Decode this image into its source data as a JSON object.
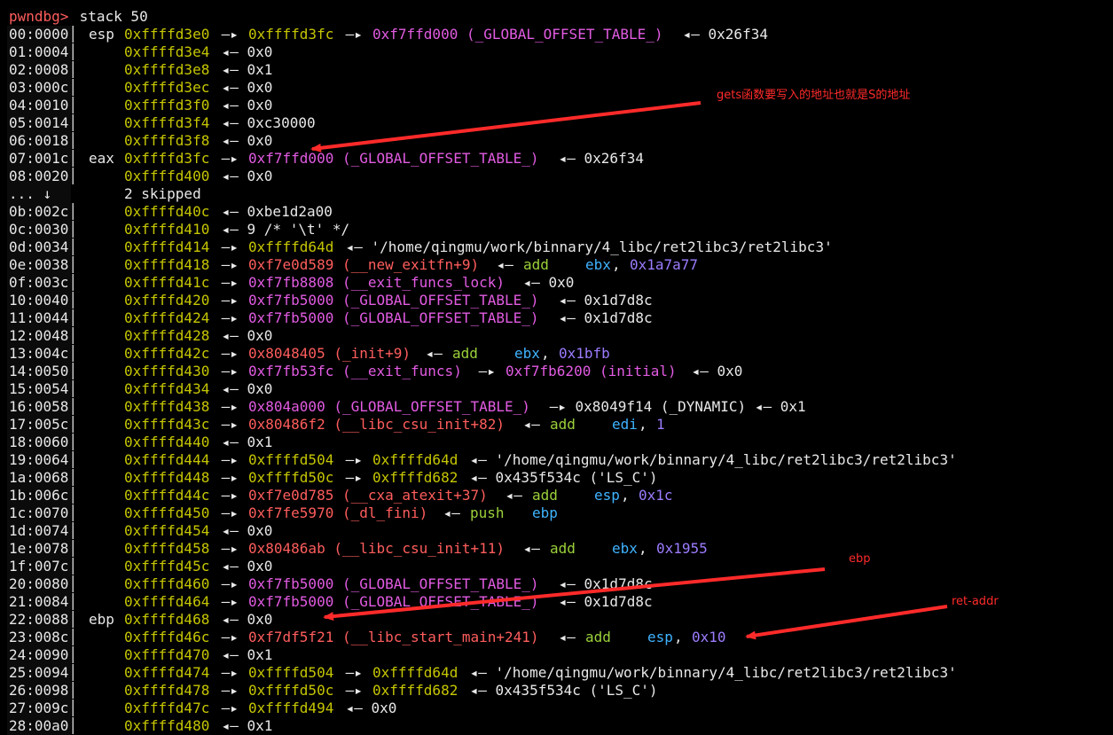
{
  "colors": {
    "default": "#e8e8e8",
    "prompt": "#ff5d5d",
    "stack": "#c6c600",
    "heap": "#e25be2",
    "code": "#ff5d5d",
    "mnemonic": "#9bd13a",
    "register": "#3fb3ff",
    "number": "#9c7cff",
    "annotation": "#ff2a2a"
  },
  "prompt": {
    "name": "pwndbg>",
    "command": " stack 50"
  },
  "stack_lines": [
    {
      "segs": [
        [
          "00:0000│ ",
          "default"
        ],
        [
          "esp ",
          "default"
        ],
        [
          "0xffffd3e0",
          "stack"
        ],
        [
          " —▸ ",
          "default"
        ],
        [
          "0xffffd3fc",
          "stack"
        ],
        [
          " —▸ ",
          "default"
        ],
        [
          "0xf7ffd000 (_GLOBAL_OFFSET_TABLE_)",
          "heap"
        ],
        [
          " ◂— 0x26f34",
          "default"
        ]
      ]
    },
    {
      "segs": [
        [
          "01:0004│ ",
          "default"
        ],
        [
          "    ",
          "default"
        ],
        [
          "0xffffd3e4",
          "stack"
        ],
        [
          " ◂— 0x0",
          "default"
        ]
      ]
    },
    {
      "segs": [
        [
          "02:0008│ ",
          "default"
        ],
        [
          "    ",
          "default"
        ],
        [
          "0xffffd3e8",
          "stack"
        ],
        [
          " ◂— 0x1",
          "default"
        ]
      ]
    },
    {
      "segs": [
        [
          "03:000c│ ",
          "default"
        ],
        [
          "    ",
          "default"
        ],
        [
          "0xffffd3ec",
          "stack"
        ],
        [
          " ◂— 0x0",
          "default"
        ]
      ]
    },
    {
      "segs": [
        [
          "04:0010│ ",
          "default"
        ],
        [
          "    ",
          "default"
        ],
        [
          "0xffffd3f0",
          "stack"
        ],
        [
          " ◂— 0x0",
          "default"
        ]
      ]
    },
    {
      "segs": [
        [
          "05:0014│ ",
          "default"
        ],
        [
          "    ",
          "default"
        ],
        [
          "0xffffd3f4",
          "stack"
        ],
        [
          " ◂— 0xc30000",
          "default"
        ]
      ]
    },
    {
      "segs": [
        [
          "06:0018│ ",
          "default"
        ],
        [
          "    ",
          "default"
        ],
        [
          "0xffffd3f8",
          "stack"
        ],
        [
          " ◂— 0x0",
          "default"
        ]
      ]
    },
    {
      "segs": [
        [
          "07:001c│ ",
          "default"
        ],
        [
          "eax ",
          "default"
        ],
        [
          "0xffffd3fc",
          "stack"
        ],
        [
          " —▸ ",
          "default"
        ],
        [
          "0xf7ffd000 (_GLOBAL_OFFSET_TABLE_)",
          "heap"
        ],
        [
          " ◂— 0x26f34",
          "default"
        ]
      ]
    },
    {
      "segs": [
        [
          "08:0020│ ",
          "default"
        ],
        [
          "    ",
          "default"
        ],
        [
          "0xffffd400",
          "stack"
        ],
        [
          " ◂— 0x0",
          "default"
        ]
      ]
    },
    {
      "segs": [
        [
          "... ↓   ",
          "default"
        ],
        [
          "     ",
          "default"
        ],
        [
          "2 skipped",
          "default"
        ]
      ]
    },
    {
      "segs": [
        [
          "0b:002c│ ",
          "default"
        ],
        [
          "    ",
          "default"
        ],
        [
          "0xffffd40c",
          "stack"
        ],
        [
          " ◂— 0xbe1d2a00",
          "default"
        ]
      ]
    },
    {
      "segs": [
        [
          "0c:0030│ ",
          "default"
        ],
        [
          "    ",
          "default"
        ],
        [
          "0xffffd410",
          "stack"
        ],
        [
          " ◂— 9 /* '\\t' */",
          "default"
        ]
      ]
    },
    {
      "segs": [
        [
          "0d:0034│ ",
          "default"
        ],
        [
          "    ",
          "default"
        ],
        [
          "0xffffd414",
          "stack"
        ],
        [
          " —▸ ",
          "default"
        ],
        [
          "0xffffd64d",
          "stack"
        ],
        [
          " ◂— '/home/qingmu/work/binnary/4_libc/ret2libc3/ret2libc3'",
          "default"
        ]
      ]
    },
    {
      "segs": [
        [
          "0e:0038│ ",
          "default"
        ],
        [
          "    ",
          "default"
        ],
        [
          "0xffffd418",
          "stack"
        ],
        [
          " —▸ ",
          "default"
        ],
        [
          "0xf7e0d589 (__new_exitfn+9)",
          "code"
        ],
        [
          " ◂— ",
          "default"
        ],
        [
          "add",
          "mnemonic"
        ],
        [
          "    ",
          "default"
        ],
        [
          "ebx",
          "register"
        ],
        [
          ", ",
          "default"
        ],
        [
          "0x1a7a77",
          "number"
        ]
      ]
    },
    {
      "segs": [
        [
          "0f:003c│ ",
          "default"
        ],
        [
          "    ",
          "default"
        ],
        [
          "0xffffd41c",
          "stack"
        ],
        [
          " —▸ ",
          "default"
        ],
        [
          "0xf7fb8808 (__exit_funcs_lock)",
          "heap"
        ],
        [
          " ◂— 0x0",
          "default"
        ]
      ]
    },
    {
      "segs": [
        [
          "10:0040│ ",
          "default"
        ],
        [
          "    ",
          "default"
        ],
        [
          "0xffffd420",
          "stack"
        ],
        [
          " —▸ ",
          "default"
        ],
        [
          "0xf7fb5000 (_GLOBAL_OFFSET_TABLE_)",
          "heap"
        ],
        [
          " ◂— 0x1d7d8c",
          "default"
        ]
      ]
    },
    {
      "segs": [
        [
          "11:0044│ ",
          "default"
        ],
        [
          "    ",
          "default"
        ],
        [
          "0xffffd424",
          "stack"
        ],
        [
          " —▸ ",
          "default"
        ],
        [
          "0xf7fb5000 (_GLOBAL_OFFSET_TABLE_)",
          "heap"
        ],
        [
          " ◂— 0x1d7d8c",
          "default"
        ]
      ]
    },
    {
      "segs": [
        [
          "12:0048│ ",
          "default"
        ],
        [
          "    ",
          "default"
        ],
        [
          "0xffffd428",
          "stack"
        ],
        [
          " ◂— 0x0",
          "default"
        ]
      ]
    },
    {
      "segs": [
        [
          "13:004c│ ",
          "default"
        ],
        [
          "    ",
          "default"
        ],
        [
          "0xffffd42c",
          "stack"
        ],
        [
          " —▸ ",
          "default"
        ],
        [
          "0x8048405 (_init+9)",
          "code"
        ],
        [
          " ◂— ",
          "default"
        ],
        [
          "add",
          "mnemonic"
        ],
        [
          "    ",
          "default"
        ],
        [
          "ebx",
          "register"
        ],
        [
          ", ",
          "default"
        ],
        [
          "0x1bfb",
          "number"
        ]
      ]
    },
    {
      "segs": [
        [
          "14:0050│ ",
          "default"
        ],
        [
          "    ",
          "default"
        ],
        [
          "0xffffd430",
          "stack"
        ],
        [
          " —▸ ",
          "default"
        ],
        [
          "0xf7fb53fc (__exit_funcs)",
          "heap"
        ],
        [
          " —▸ ",
          "default"
        ],
        [
          "0xf7fb6200 (initial)",
          "heap"
        ],
        [
          " ◂— 0x0",
          "default"
        ]
      ]
    },
    {
      "segs": [
        [
          "15:0054│ ",
          "default"
        ],
        [
          "    ",
          "default"
        ],
        [
          "0xffffd434",
          "stack"
        ],
        [
          " ◂— 0x0",
          "default"
        ]
      ]
    },
    {
      "segs": [
        [
          "16:0058│ ",
          "default"
        ],
        [
          "    ",
          "default"
        ],
        [
          "0xffffd438",
          "stack"
        ],
        [
          " —▸ ",
          "default"
        ],
        [
          "0x804a000 (_GLOBAL_OFFSET_TABLE_)",
          "heap"
        ],
        [
          " —▸ 0x8049f14 (_DYNAMIC) ◂— 0x1",
          "default"
        ]
      ]
    },
    {
      "segs": [
        [
          "17:005c│ ",
          "default"
        ],
        [
          "    ",
          "default"
        ],
        [
          "0xffffd43c",
          "stack"
        ],
        [
          " —▸ ",
          "default"
        ],
        [
          "0x80486f2 (__libc_csu_init+82)",
          "code"
        ],
        [
          " ◂— ",
          "default"
        ],
        [
          "add",
          "mnemonic"
        ],
        [
          "    ",
          "default"
        ],
        [
          "edi",
          "register"
        ],
        [
          ", ",
          "default"
        ],
        [
          "1",
          "number"
        ]
      ]
    },
    {
      "segs": [
        [
          "18:0060│ ",
          "default"
        ],
        [
          "    ",
          "default"
        ],
        [
          "0xffffd440",
          "stack"
        ],
        [
          " ◂— 0x1",
          "default"
        ]
      ]
    },
    {
      "segs": [
        [
          "19:0064│ ",
          "default"
        ],
        [
          "    ",
          "default"
        ],
        [
          "0xffffd444",
          "stack"
        ],
        [
          " —▸ ",
          "default"
        ],
        [
          "0xffffd504",
          "stack"
        ],
        [
          " —▸ ",
          "default"
        ],
        [
          "0xffffd64d",
          "stack"
        ],
        [
          " ◂— '/home/qingmu/work/binnary/4_libc/ret2libc3/ret2libc3'",
          "default"
        ]
      ]
    },
    {
      "segs": [
        [
          "1a:0068│ ",
          "default"
        ],
        [
          "    ",
          "default"
        ],
        [
          "0xffffd448",
          "stack"
        ],
        [
          " —▸ ",
          "default"
        ],
        [
          "0xffffd50c",
          "stack"
        ],
        [
          " —▸ ",
          "default"
        ],
        [
          "0xffffd682",
          "stack"
        ],
        [
          " ◂— 0x435f534c ('LS_C')",
          "default"
        ]
      ]
    },
    {
      "segs": [
        [
          "1b:006c│ ",
          "default"
        ],
        [
          "    ",
          "default"
        ],
        [
          "0xffffd44c",
          "stack"
        ],
        [
          " —▸ ",
          "default"
        ],
        [
          "0xf7e0d785 (__cxa_atexit+37)",
          "code"
        ],
        [
          " ◂— ",
          "default"
        ],
        [
          "add",
          "mnemonic"
        ],
        [
          "    ",
          "default"
        ],
        [
          "esp",
          "register"
        ],
        [
          ", ",
          "default"
        ],
        [
          "0x1c",
          "number"
        ]
      ]
    },
    {
      "segs": [
        [
          "1c:0070│ ",
          "default"
        ],
        [
          "    ",
          "default"
        ],
        [
          "0xffffd450",
          "stack"
        ],
        [
          " —▸ ",
          "default"
        ],
        [
          "0xf7fe5970 (_dl_fini)",
          "code"
        ],
        [
          " ◂— ",
          "default"
        ],
        [
          "push",
          "mnemonic"
        ],
        [
          "   ",
          "default"
        ],
        [
          "ebp",
          "register"
        ]
      ]
    },
    {
      "segs": [
        [
          "1d:0074│ ",
          "default"
        ],
        [
          "    ",
          "default"
        ],
        [
          "0xffffd454",
          "stack"
        ],
        [
          " ◂— 0x0",
          "default"
        ]
      ]
    },
    {
      "segs": [
        [
          "1e:0078│ ",
          "default"
        ],
        [
          "    ",
          "default"
        ],
        [
          "0xffffd458",
          "stack"
        ],
        [
          " —▸ ",
          "default"
        ],
        [
          "0x80486ab (__libc_csu_init+11)",
          "code"
        ],
        [
          " ◂— ",
          "default"
        ],
        [
          "add",
          "mnemonic"
        ],
        [
          "    ",
          "default"
        ],
        [
          "ebx",
          "register"
        ],
        [
          ", ",
          "default"
        ],
        [
          "0x1955",
          "number"
        ]
      ]
    },
    {
      "segs": [
        [
          "1f:007c│ ",
          "default"
        ],
        [
          "    ",
          "default"
        ],
        [
          "0xffffd45c",
          "stack"
        ],
        [
          " ◂— 0x0",
          "default"
        ]
      ]
    },
    {
      "segs": [
        [
          "20:0080│ ",
          "default"
        ],
        [
          "    ",
          "default"
        ],
        [
          "0xffffd460",
          "stack"
        ],
        [
          " —▸ ",
          "default"
        ],
        [
          "0xf7fb5000 (_GLOBAL_OFFSET_TABLE_)",
          "heap"
        ],
        [
          " ◂— 0x1d7d8c",
          "default"
        ]
      ]
    },
    {
      "segs": [
        [
          "21:0084│ ",
          "default"
        ],
        [
          "    ",
          "default"
        ],
        [
          "0xffffd464",
          "stack"
        ],
        [
          " —▸ ",
          "default"
        ],
        [
          "0xf7fb5000 (_GLOBAL_OFFSET_TABLE_)",
          "heap"
        ],
        [
          " ◂— 0x1d7d8c",
          "default"
        ]
      ]
    },
    {
      "segs": [
        [
          "22:0088│ ",
          "default"
        ],
        [
          "ebp ",
          "default"
        ],
        [
          "0xffffd468",
          "stack"
        ],
        [
          " ◂— 0x0",
          "default"
        ]
      ]
    },
    {
      "segs": [
        [
          "23:008c│ ",
          "default"
        ],
        [
          "    ",
          "default"
        ],
        [
          "0xffffd46c",
          "stack"
        ],
        [
          " —▸ ",
          "default"
        ],
        [
          "0xf7df5f21 (__libc_start_main+241)",
          "code"
        ],
        [
          " ◂— ",
          "default"
        ],
        [
          "add",
          "mnemonic"
        ],
        [
          "    ",
          "default"
        ],
        [
          "esp",
          "register"
        ],
        [
          ", ",
          "default"
        ],
        [
          "0x10",
          "number"
        ]
      ]
    },
    {
      "segs": [
        [
          "24:0090│ ",
          "default"
        ],
        [
          "    ",
          "default"
        ],
        [
          "0xffffd470",
          "stack"
        ],
        [
          " ◂— 0x1",
          "default"
        ]
      ]
    },
    {
      "segs": [
        [
          "25:0094│ ",
          "default"
        ],
        [
          "    ",
          "default"
        ],
        [
          "0xffffd474",
          "stack"
        ],
        [
          " —▸ ",
          "default"
        ],
        [
          "0xffffd504",
          "stack"
        ],
        [
          " —▸ ",
          "default"
        ],
        [
          "0xffffd64d",
          "stack"
        ],
        [
          " ◂— '/home/qingmu/work/binnary/4_libc/ret2libc3/ret2libc3'",
          "default"
        ]
      ]
    },
    {
      "segs": [
        [
          "26:0098│ ",
          "default"
        ],
        [
          "    ",
          "default"
        ],
        [
          "0xffffd478",
          "stack"
        ],
        [
          " —▸ ",
          "default"
        ],
        [
          "0xffffd50c",
          "stack"
        ],
        [
          " —▸ ",
          "default"
        ],
        [
          "0xffffd682",
          "stack"
        ],
        [
          " ◂— 0x435f534c ('LS_C')",
          "default"
        ]
      ]
    },
    {
      "segs": [
        [
          "27:009c│ ",
          "default"
        ],
        [
          "    ",
          "default"
        ],
        [
          "0xffffd47c",
          "stack"
        ],
        [
          " —▸ ",
          "default"
        ],
        [
          "0xffffd494",
          "stack"
        ],
        [
          " ◂— 0x0",
          "default"
        ]
      ]
    },
    {
      "segs": [
        [
          "28:00a0│ ",
          "default"
        ],
        [
          "    ",
          "default"
        ],
        [
          "0xffffd480",
          "stack"
        ],
        [
          " ◂— 0x1",
          "default"
        ]
      ]
    }
  ],
  "annotations": [
    {
      "text": "gets函数要写入的地址也就是S的地址"
    },
    {
      "text": "ebp"
    },
    {
      "text": "ret-addr"
    }
  ]
}
